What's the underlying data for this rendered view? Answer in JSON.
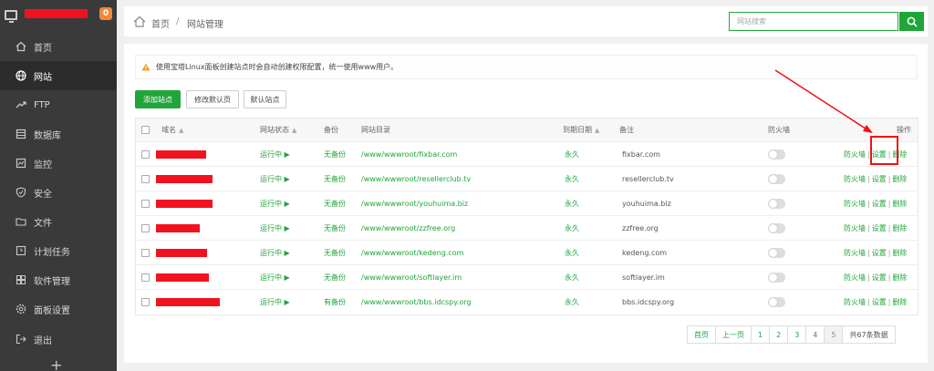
{
  "sidebar": {
    "badge": "0",
    "items": [
      {
        "label": "首页",
        "icon": "home-icon"
      },
      {
        "label": "网站",
        "icon": "globe-icon"
      },
      {
        "label": "FTP",
        "icon": "ftp-icon"
      },
      {
        "label": "数据库",
        "icon": "database-icon"
      },
      {
        "label": "监控",
        "icon": "monitor-icon"
      },
      {
        "label": "安全",
        "icon": "shield-icon"
      },
      {
        "label": "文件",
        "icon": "folder-icon"
      },
      {
        "label": "计划任务",
        "icon": "clock-icon"
      },
      {
        "label": "软件管理",
        "icon": "grid-icon"
      },
      {
        "label": "面板设置",
        "icon": "gear-icon"
      },
      {
        "label": "退出",
        "icon": "logout-icon"
      }
    ],
    "add": "+"
  },
  "topbar": {
    "breadcrumb_home": "首页",
    "breadcrumb_sep": "/",
    "breadcrumb_current": "网站管理",
    "search_placeholder": "网站搜索"
  },
  "alert": {
    "text": "使用宝塔Linux面板创建站点时会自动创建权限配置，统一使用www用户。"
  },
  "buttons": {
    "add_site": "添加站点",
    "modify_default_page": "修改默认页",
    "default_site": "默认站点"
  },
  "table": {
    "headers": {
      "name": "域名",
      "status": "网站状态",
      "backup": "备份",
      "root": "网站目录",
      "expire": "到期日期",
      "note": "备注",
      "firewall": "防火墙",
      "ops": "操作"
    },
    "rows": [
      {
        "status": "运行中 ▶",
        "backup": "无备份",
        "root": "/www/wwwroot/fixbar.com",
        "expire": "永久",
        "note": "fixbar.com",
        "firewall_link": "防火墙",
        "settings": "设置",
        "delete": "删除"
      },
      {
        "status": "运行中 ▶",
        "backup": "无备份",
        "root": "/www/wwwroot/resellerclub.tv",
        "expire": "永久",
        "note": "resellerclub.tv",
        "firewall_link": "防火墙",
        "settings": "设置",
        "delete": "删除"
      },
      {
        "status": "运行中 ▶",
        "backup": "无备份",
        "root": "/www/wwwroot/youhuima.biz",
        "expire": "永久",
        "note": "youhuima.biz",
        "firewall_link": "防火墙",
        "settings": "设置",
        "delete": "删除"
      },
      {
        "status": "运行中 ▶",
        "backup": "无备份",
        "root": "/www/wwwroot/zzfree.org",
        "expire": "永久",
        "note": "zzfree.org",
        "firewall_link": "防火墙",
        "settings": "设置",
        "delete": "删除"
      },
      {
        "status": "运行中 ▶",
        "backup": "无备份",
        "root": "/www/wwwroot/kedeng.com",
        "expire": "永久",
        "note": "kedeng.com",
        "firewall_link": "防火墙",
        "settings": "设置",
        "delete": "删除"
      },
      {
        "status": "运行中 ▶",
        "backup": "无备份",
        "root": "/www/wwwroot/softlayer.im",
        "expire": "永久",
        "note": "softlayer.im",
        "firewall_link": "防火墙",
        "settings": "设置",
        "delete": "删除"
      },
      {
        "status": "运行中 ▶",
        "backup": "有备份",
        "root": "/www/wwwroot/bbs.idcspy.org",
        "expire": "永久",
        "note": "bbs.idcspy.org",
        "firewall_link": "防火墙",
        "settings": "设置",
        "delete": "删除"
      }
    ]
  },
  "pagination": {
    "first": "首页",
    "prev": "上一页",
    "pages": [
      "1",
      "2",
      "3",
      "4",
      "5"
    ],
    "current": "5",
    "total": "共67条数据"
  },
  "colors": {
    "accent": "#20a53a",
    "sidebar_bg": "#3a3a3a",
    "badge": "#f0883a",
    "annotation": "#f01010"
  }
}
